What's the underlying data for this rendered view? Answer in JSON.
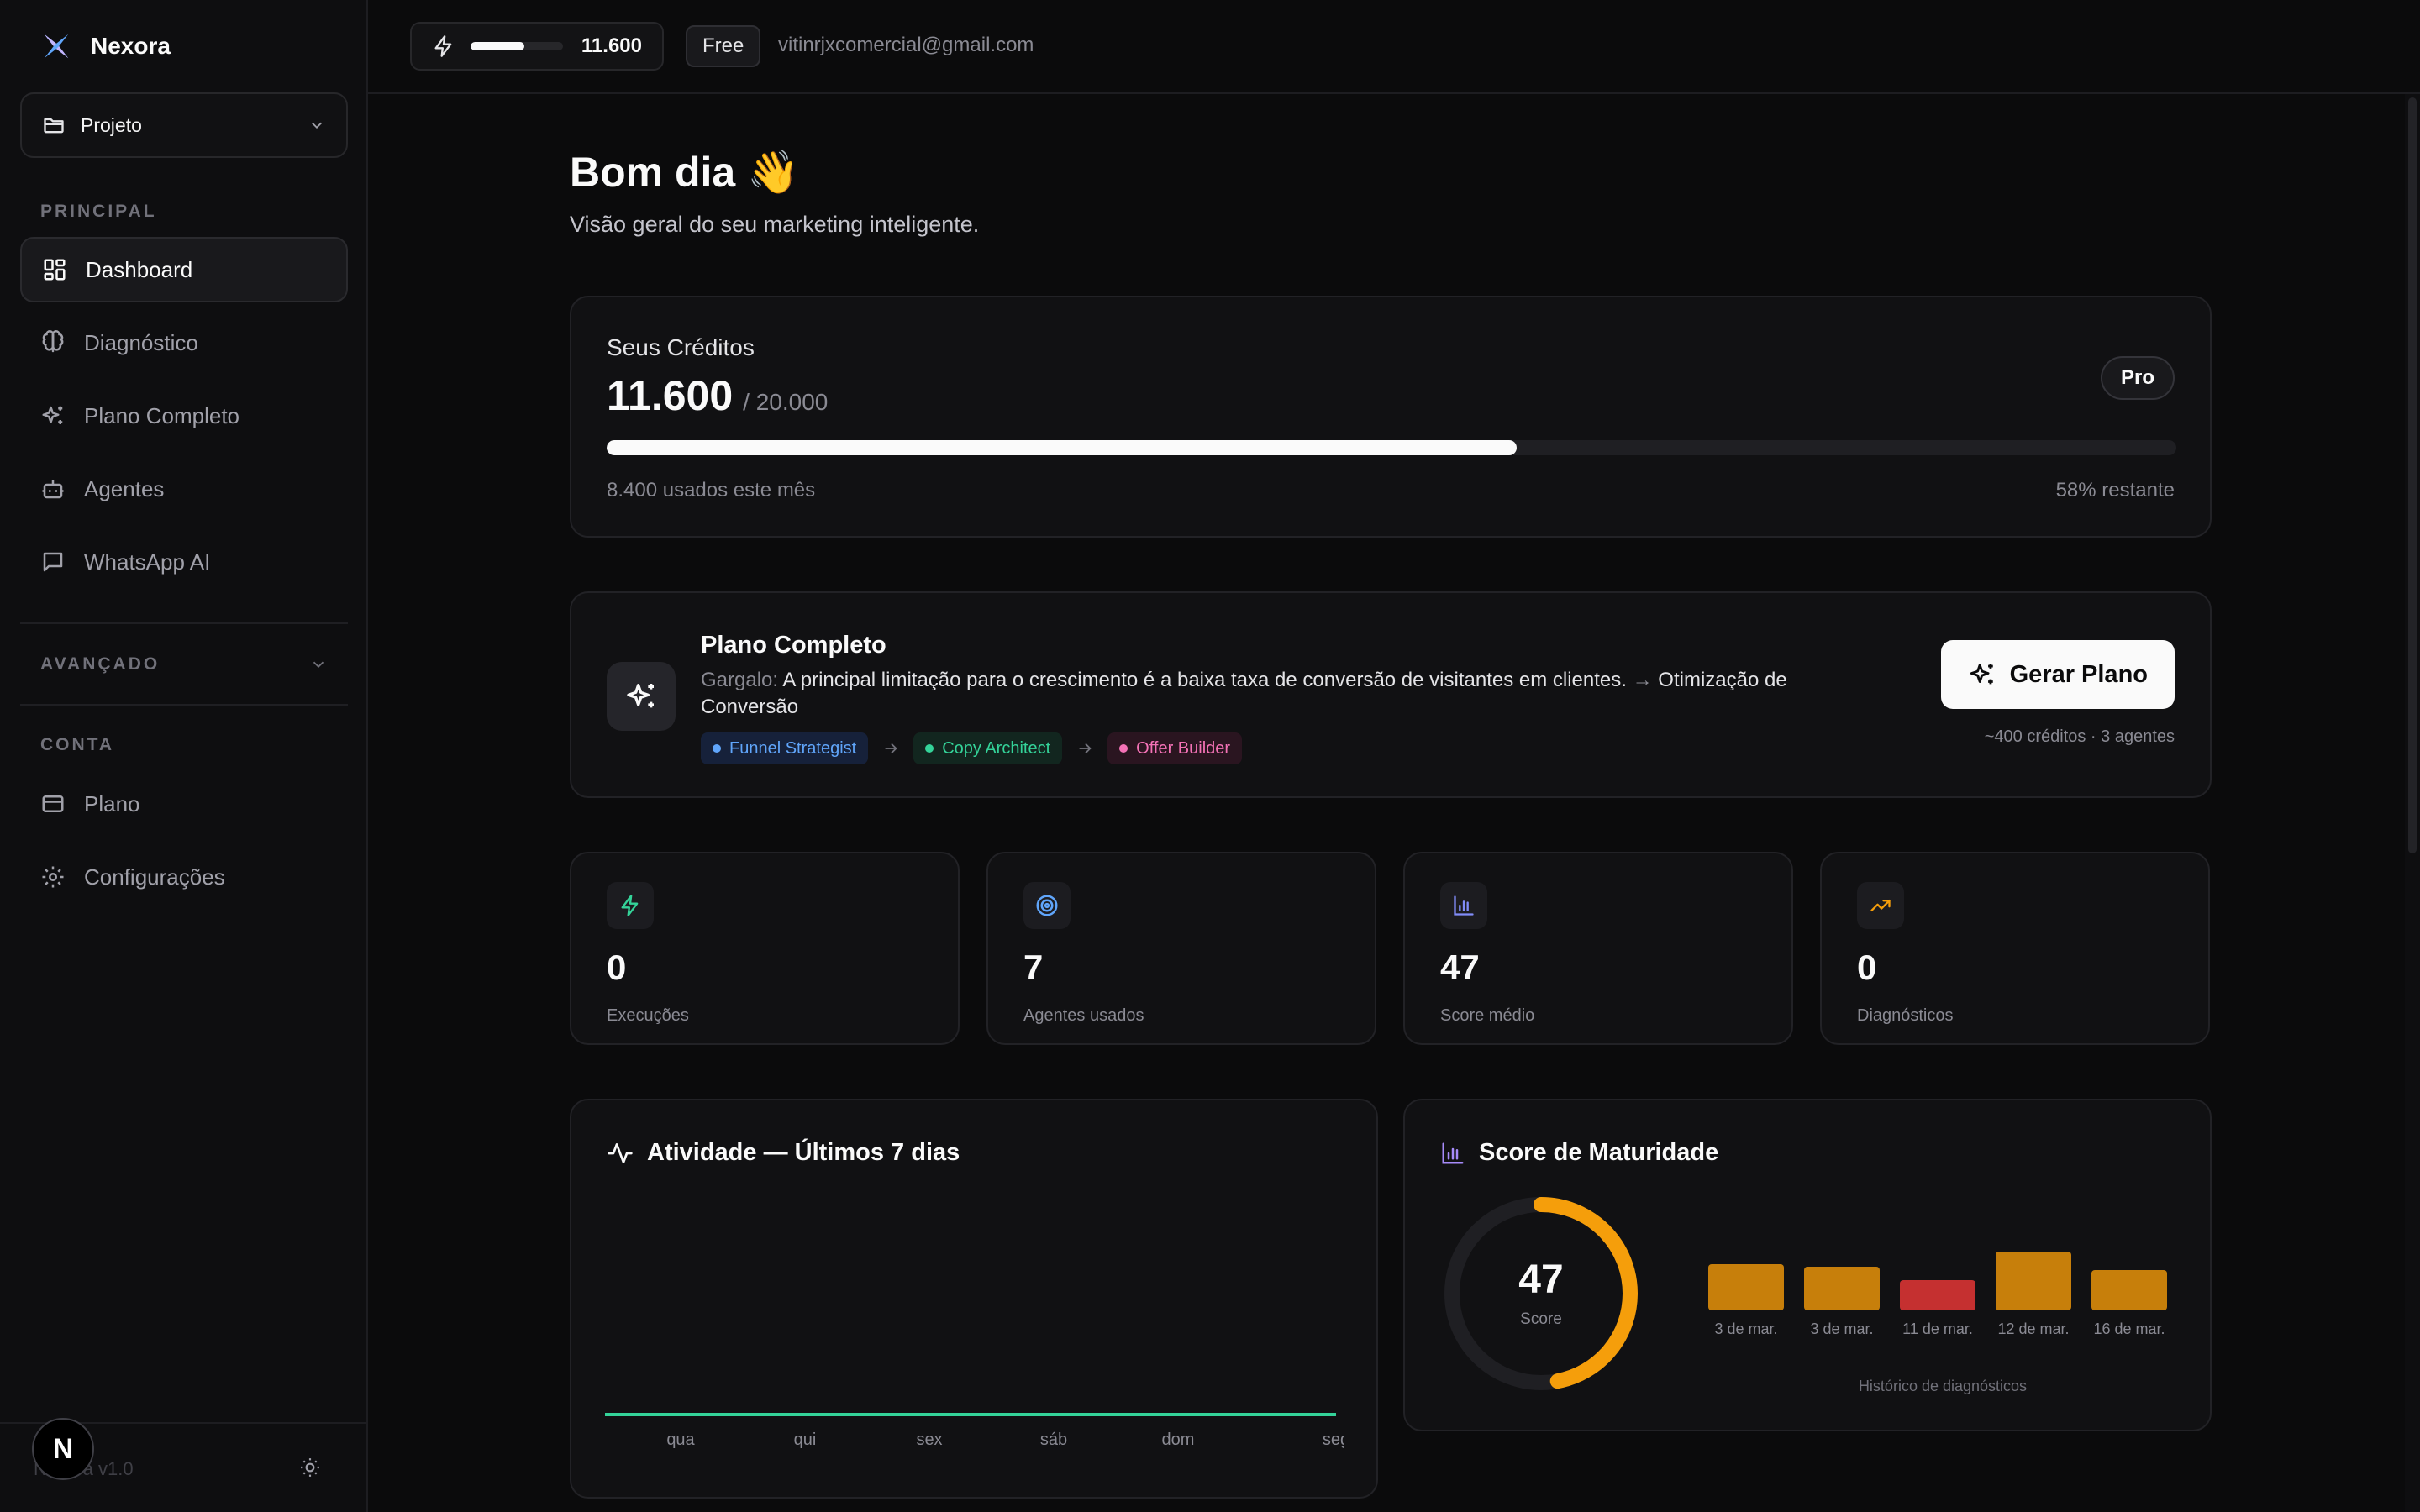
{
  "app": {
    "name": "Nexora",
    "version": "v1.0",
    "footer_badge": "N"
  },
  "sidebar": {
    "project_label": "Projeto",
    "section_principal": "PRINCIPAL",
    "section_avancado": "AVANÇADO",
    "section_conta": "CONTA",
    "items": [
      {
        "label": "Dashboard",
        "icon": "layout-grid-icon"
      },
      {
        "label": "Diagnóstico",
        "icon": "brain-icon"
      },
      {
        "label": "Plano Completo",
        "icon": "sparkles-icon"
      },
      {
        "label": "Agentes",
        "icon": "bot-icon"
      },
      {
        "label": "WhatsApp AI",
        "icon": "message-square-icon"
      }
    ],
    "account_items": [
      {
        "label": "Plano",
        "icon": "credit-card-icon"
      },
      {
        "label": "Configurações",
        "icon": "gear-icon"
      }
    ]
  },
  "topbar": {
    "credits": "11.600",
    "credits_fraction": 0.58,
    "plan_badge": "Free",
    "email": "vitinrjxcomercial@gmail.com"
  },
  "main": {
    "greeting": "Bom dia 👋",
    "subtitle": "Visão geral do seu marketing inteligente.",
    "credits_card": {
      "title": "Seus Créditos",
      "amount": "11.600",
      "total": "/ 20.000",
      "badge": "Pro",
      "remaining_fraction": 0.58,
      "used_text": "8.400 usados este mês",
      "remaining_text": "58% restante"
    },
    "plan_card": {
      "title": "Plano Completo",
      "bottleneck_label": "Gargalo:",
      "bottleneck_text": "A principal limitação para o crescimento é a baixa taxa de conversão de visitantes em clientes.",
      "arrow": "→",
      "solution": "Otimização de Conversão",
      "agents": [
        {
          "name": "Funnel Strategist",
          "color": "#60a5fa",
          "bg": "#16213a"
        },
        {
          "name": "Copy Architect",
          "color": "#34d399",
          "bg": "#12261f"
        },
        {
          "name": "Offer Builder",
          "color": "#f472b6",
          "bg": "#2a1520"
        }
      ],
      "button": "Gerar Plano",
      "meta": "~400 créditos · 3 agentes"
    },
    "stats": [
      {
        "value": "0",
        "label": "Execuções",
        "icon": "zap-icon",
        "color": "#34d399"
      },
      {
        "value": "7",
        "label": "Agentes usados",
        "icon": "target-icon",
        "color": "#60a5fa"
      },
      {
        "value": "47",
        "label": "Score médio",
        "icon": "bar-chart-icon",
        "color": "#818cf8"
      },
      {
        "value": "0",
        "label": "Diagnósticos",
        "icon": "trending-up-icon",
        "color": "#f59e0b"
      }
    ],
    "activity": {
      "title": "Atividade — Últimos 7 dias"
    },
    "maturity": {
      "title": "Score de Maturidade",
      "score": "47",
      "score_value": 47,
      "score_label": "Score",
      "caption": "Histórico de diagnósticos"
    }
  },
  "chart_data": [
    {
      "type": "line",
      "title": "Atividade — Últimos 7 dias",
      "categories": [
        "qua",
        "qui",
        "sex",
        "sáb",
        "dom",
        "seg"
      ],
      "series": [
        {
          "values": [
            0,
            0,
            0,
            0,
            0,
            0
          ]
        }
      ],
      "color": "#34d399"
    },
    {
      "type": "bar",
      "title": "Histórico de diagnósticos",
      "categories": [
        "3 de mar.",
        "3 de mar.",
        "11 de mar.",
        "12 de mar.",
        "16 de mar."
      ],
      "values": [
        55,
        52,
        36,
        70,
        48
      ],
      "colors": [
        "#c77f0b",
        "#c77f0b",
        "#c53030",
        "#c77f0b",
        "#c77f0b"
      ]
    }
  ]
}
